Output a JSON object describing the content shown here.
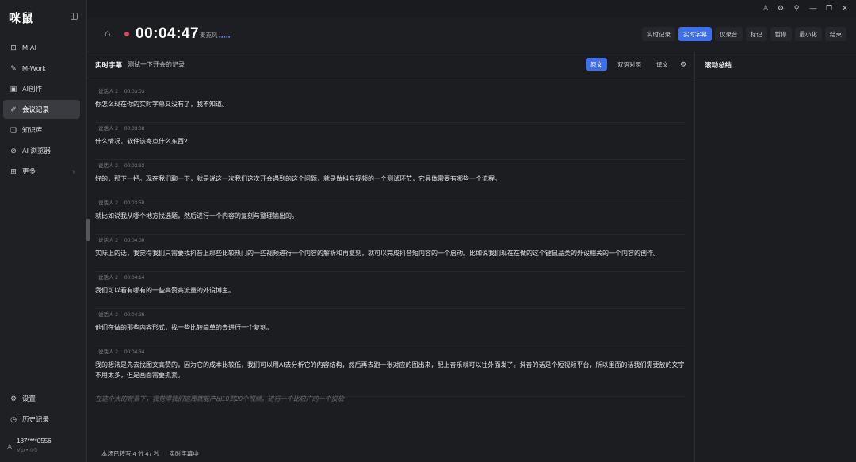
{
  "app": {
    "logo": "咪鼠"
  },
  "sidebar": {
    "items": [
      {
        "label": "M-AI",
        "icon": "chat-icon",
        "glyph": "⊡"
      },
      {
        "label": "M-Work",
        "icon": "brush-icon",
        "glyph": "✎"
      },
      {
        "label": "AI创作",
        "icon": "image-icon",
        "glyph": "▣"
      },
      {
        "label": "会议记录",
        "icon": "meeting-notes-icon",
        "glyph": "✐",
        "active": true
      },
      {
        "label": "知识库",
        "icon": "book-icon",
        "glyph": "❏"
      },
      {
        "label": "AI 浏览器",
        "icon": "compass-icon",
        "glyph": "⊘"
      },
      {
        "label": "更多",
        "icon": "grid-icon",
        "glyph": "⊞",
        "arrow": "›"
      }
    ],
    "bottom": [
      {
        "label": "设置",
        "icon": "gear-icon",
        "glyph": "⚙"
      },
      {
        "label": "历史记录",
        "icon": "clock-icon",
        "glyph": "◷"
      }
    ],
    "user": {
      "name": "187****0556",
      "vip": "Vip  •  ⊙5"
    }
  },
  "window_controls": {
    "user": "♙",
    "settings": "⚙",
    "pin": "⚲",
    "minimize": "—",
    "restore": "❐",
    "close": "✕"
  },
  "header": {
    "timer": "00:04:47",
    "mic_label": "麦克风",
    "mic_level": "▪▪▪▪▪",
    "buttons": [
      {
        "label": "实时记录",
        "active": false
      },
      {
        "label": "实时字幕",
        "active": true
      },
      {
        "label": "仪录音",
        "active": false
      },
      {
        "label": "标记",
        "active": false
      },
      {
        "label": "暂停",
        "active": false
      },
      {
        "label": "最小化",
        "active": false
      },
      {
        "label": "结束",
        "active": false
      }
    ]
  },
  "transcript": {
    "title": "实时字幕",
    "subtitle": "测试一下开会的记录",
    "tabs": [
      {
        "label": "原文",
        "active": true
      },
      {
        "label": "双语对照",
        "active": false
      },
      {
        "label": "译文",
        "active": false
      }
    ],
    "entries": [
      {
        "speaker": "说话人 2",
        "time": "00:03:03",
        "text": "你怎么现在你的实时字幕又没有了，我不知道。"
      },
      {
        "speaker": "说话人 2",
        "time": "00:03:08",
        "text": "什么情况，软件该寄点什么东西?"
      },
      {
        "speaker": "说话人 2",
        "time": "00:03:33",
        "text": "好的，那下一把。现在我们聊一下，就是说这一次我们这次开会遇到的这个问题，就是做抖音视频的一个测试环节，它具体需要有哪些一个流程。"
      },
      {
        "speaker": "说话人 2",
        "time": "00:03:50",
        "text": "就比如说我从哪个地方找选题，然后进行一个内容的复刻与整理输出的。"
      },
      {
        "speaker": "说话人 2",
        "time": "00:04:00",
        "text": "实际上的话，我觉得我们只需要找抖音上那些比较热门的一些视频进行一个内容的解析和再复刻，就可以完成抖音短内容的一个启动。比如说我们现在在做的这个键鼠品类的外设相关的一个内容的创作。"
      },
      {
        "speaker": "说话人 2",
        "time": "00:04:14",
        "text": "我们可以看有哪有的一些高赞高流量的外设博主。"
      },
      {
        "speaker": "说话人 2",
        "time": "00:04:26",
        "text": "他们在做的那些内容形式，找一些比较简单的去进行一个复刻。"
      },
      {
        "speaker": "说话人 2",
        "time": "00:04:34",
        "text": "我的想法是先去找图文高赞的，因为它的成本比较低，我们可以用AI去分析它的内容结构，然后再去跑一张对应的图出来，配上音乐就可以往外面发了。抖音的话是个短视频平台，所以里面的话我们需要放的文字不用太多，但是画面需要抓紧。"
      }
    ],
    "live_text": "在这个大的背景下，我觉得我们这周就能产出10到20个视频，进行一个比较广的一个投放",
    "status_duration": "本场已转写 4 分 47 秒",
    "status_mode": "实时字幕中"
  },
  "summary": {
    "title": "滚动总结"
  }
}
